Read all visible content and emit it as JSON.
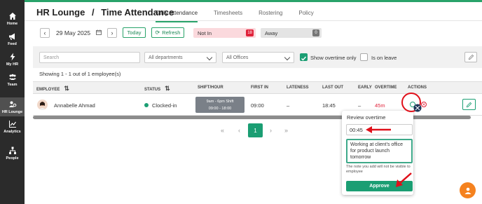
{
  "sidebar": {
    "items": [
      {
        "label": "Home",
        "icon": "home-icon"
      },
      {
        "label": "Feed",
        "icon": "megaphone-icon"
      },
      {
        "label": "My HR",
        "icon": "lightning-icon"
      },
      {
        "label": "Team",
        "icon": "team-icon"
      },
      {
        "label": "HR Lounge",
        "icon": "hr-lounge-icon"
      },
      {
        "label": "Analytics",
        "icon": "chart-icon"
      },
      {
        "label": "People",
        "icon": "people-icon"
      }
    ]
  },
  "header": {
    "breadcrumb_root": "HR Lounge",
    "separator": "/",
    "breadcrumb_page": "Time Attendance",
    "tabs": [
      {
        "label": "Daily Attendance",
        "active": true
      },
      {
        "label": "Timesheets"
      },
      {
        "label": "Rostering"
      },
      {
        "label": "Policy"
      }
    ]
  },
  "date_bar": {
    "date": "29 May 2025",
    "today_label": "Today",
    "refresh_label": "Refresh",
    "not_in_label": "Not In",
    "not_in_count": "18",
    "away_label": "Away",
    "away_count": "0"
  },
  "filters": {
    "search_placeholder": "Search",
    "departments": "All departments",
    "offices": "All Offices",
    "show_overtime_label": "Show overtime only",
    "show_overtime_checked": true,
    "on_leave_label": "Is on leave",
    "on_leave_checked": false
  },
  "showing_text": "Showing 1 - 1 out of 1 employee(s)",
  "table": {
    "columns": [
      "EMPLOYEE",
      "STATUS",
      "SHIFT/HOUR",
      "FIRST IN",
      "LATENESS",
      "LAST OUT",
      "EARLY",
      "OVERTIME",
      "ACTIONS"
    ],
    "rows": [
      {
        "employee": "Annabelle Ahmad",
        "status": "Clocked-in",
        "shift_name": "9am - 6pm Shift",
        "shift_hours": "09:00 - 18:00",
        "first_in": "09:00",
        "lateness": "–",
        "last_out": "18:45",
        "early": "–",
        "overtime": "45m"
      }
    ]
  },
  "pagination": {
    "first": "«",
    "prev": "‹",
    "current": "1",
    "next": "›",
    "last": "»"
  },
  "review_popover": {
    "title": "Review overtime",
    "duration": "00:45",
    "note": "Working at client's office for product launch tomorrow",
    "hint": "The note you add will not be visible to employee",
    "approve_label": "Approve"
  },
  "colors": {
    "accent": "#1b9e73",
    "danger": "#e0223a",
    "sidebar": "#2b2b2b",
    "chat": "#f5821f"
  }
}
